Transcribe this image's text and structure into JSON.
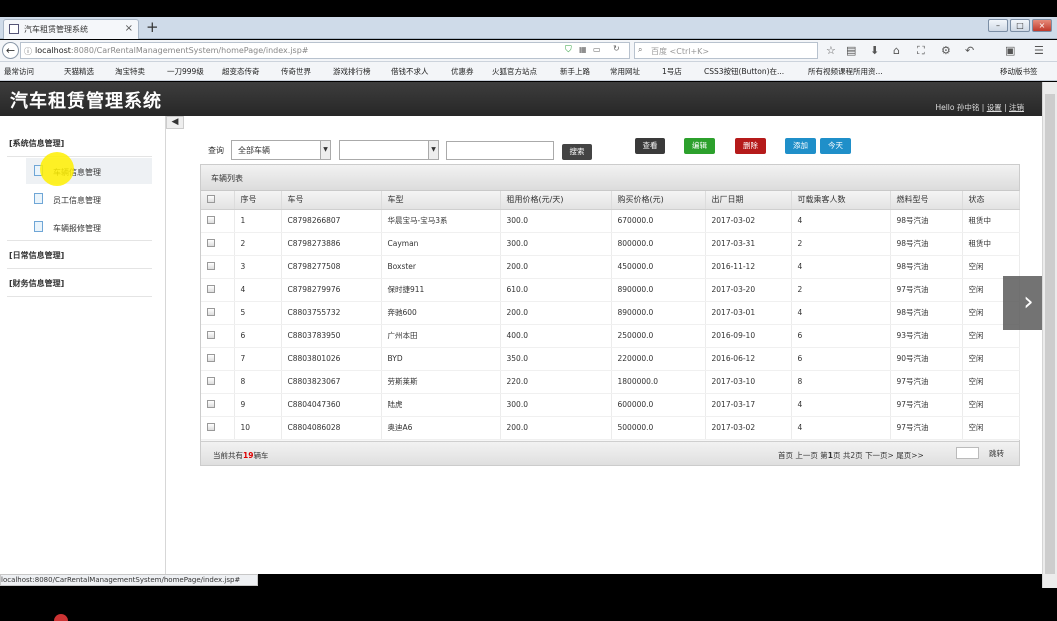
{
  "browser": {
    "tab_title": "汽车租赁管理系统",
    "tab_close": "×",
    "new_tab": "+",
    "url_host": "localhost",
    "url_rest": ":8080/CarRentalManagementSystem/homePage/index.jsp#",
    "search_placeholder": "百度 <Ctrl+K>",
    "bookmarks": [
      "最常访问",
      "天猫精选",
      "淘宝特卖",
      "一刀999级",
      "超变态传奇",
      "传奇世界",
      "游戏排行榜",
      "借钱不求人",
      "优惠券",
      "火狐官方站点",
      "新手上路",
      "常用网址",
      "1号店",
      "CSS3按钮(Button)在...",
      "所有视频课程所用资...",
      "移动版书签"
    ],
    "status_url": "localhost:8080/CarRentalManagementSystem/homePage/index.jsp#"
  },
  "app": {
    "title": "汽车租赁管理系统",
    "hello": "Hello",
    "username": "孙中铭",
    "settings": "设置",
    "logout": "注销",
    "pipe": "|"
  },
  "sidebar": {
    "groups": [
      {
        "label": "[系统信息管理]",
        "items": [
          "车辆信息管理",
          "员工信息管理",
          "车辆报修管理"
        ]
      },
      {
        "label": "[日常信息管理]"
      },
      {
        "label": "[财务信息管理]"
      }
    ]
  },
  "toolbar": {
    "query_label": "查询",
    "filter_value": "全部车辆",
    "filter2_value": "",
    "search_value": "",
    "search_btn": "搜索",
    "view_btn": "查看",
    "edit_btn": "编辑",
    "delete_btn": "删除",
    "add_btn": "添加",
    "today_btn": "今天"
  },
  "table": {
    "title": "车辆列表",
    "columns": [
      "序号",
      "车号",
      "车型",
      "租用价格(元/天)",
      "购买价格(元)",
      "出厂日期",
      "可载乘客人数",
      "燃料型号",
      "状态"
    ],
    "rows": [
      [
        "1",
        "C8798266807",
        "华晨宝马-宝马3系",
        "300.0",
        "670000.0",
        "2017-03-02",
        "4",
        "98号汽油",
        "租赁中"
      ],
      [
        "2",
        "C8798273886",
        "Cayman",
        "300.0",
        "800000.0",
        "2017-03-31",
        "2",
        "98号汽油",
        "租赁中"
      ],
      [
        "3",
        "C8798277508",
        "Boxster",
        "200.0",
        "450000.0",
        "2016-11-12",
        "4",
        "98号汽油",
        "空闲"
      ],
      [
        "4",
        "C8798279976",
        "保时捷911",
        "610.0",
        "890000.0",
        "2017-03-20",
        "2",
        "97号汽油",
        "空闲"
      ],
      [
        "5",
        "C8803755732",
        "奔驰600",
        "200.0",
        "890000.0",
        "2017-03-01",
        "4",
        "98号汽油",
        "空闲"
      ],
      [
        "6",
        "C8803783950",
        "广州本田",
        "400.0",
        "250000.0",
        "2016-09-10",
        "6",
        "93号汽油",
        "空闲"
      ],
      [
        "7",
        "C8803801026",
        "BYD",
        "350.0",
        "220000.0",
        "2016-06-12",
        "6",
        "90号汽油",
        "空闲"
      ],
      [
        "8",
        "C8803823067",
        "劳斯莱斯",
        "220.0",
        "1800000.0",
        "2017-03-10",
        "8",
        "97号汽油",
        "空闲"
      ],
      [
        "9",
        "C8804047360",
        "陆虎",
        "300.0",
        "600000.0",
        "2017-03-17",
        "4",
        "97号汽油",
        "空闲"
      ],
      [
        "10",
        "C8804086028",
        "奥迪A6",
        "200.0",
        "500000.0",
        "2017-03-02",
        "4",
        "97号汽油",
        "空闲"
      ]
    ],
    "footer_prefix": "当前共有",
    "footer_count": "19",
    "footer_suffix": "辆车",
    "pager": {
      "first": "首页",
      "prev": "上一页",
      "page_prefix": "第",
      "page": "1",
      "page_suffix": "页",
      "total": "共2页",
      "next": "下一页>",
      "last": "尾页>>",
      "jump": "跳转"
    }
  },
  "colors": {
    "header_bg": "#2f2f2f",
    "view_btn": "#3a3a3a",
    "edit_btn": "#2ca02c",
    "delete_btn": "#b51a1a",
    "add_btn": "#1f8fc9",
    "today_btn": "#1f8fc9",
    "count_highlight": "#dd0000"
  }
}
